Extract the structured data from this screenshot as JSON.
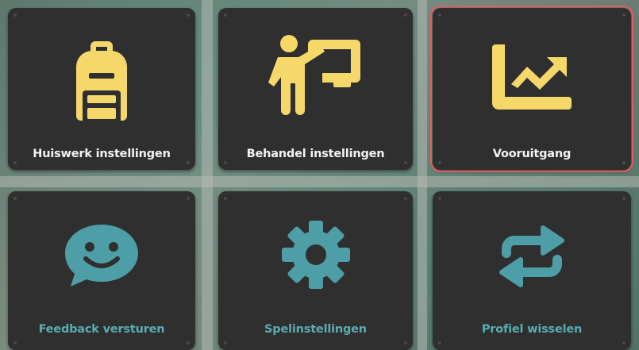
{
  "menu": {
    "items": [
      {
        "label": "Huiswerk instellingen",
        "icon": "backpack-icon",
        "selected": false
      },
      {
        "label": "Behandel instellingen",
        "icon": "teacher-board-icon",
        "selected": false
      },
      {
        "label": "Vooruitgang",
        "icon": "chart-line-icon",
        "selected": true
      },
      {
        "label": "Feedback versturen",
        "icon": "smile-chat-icon",
        "selected": false
      },
      {
        "label": "Spelinstellingen",
        "icon": "gear-icon",
        "selected": false
      },
      {
        "label": "Profiel wisselen",
        "icon": "switch-arrows-icon",
        "selected": false
      }
    ]
  },
  "colors": {
    "tile": "#2f2f2f",
    "yellow_icon": "#f6d86a",
    "teal_icon": "#4d9ea6",
    "teal_label": "#5aacb4",
    "selected_border": "#e85a5a"
  }
}
